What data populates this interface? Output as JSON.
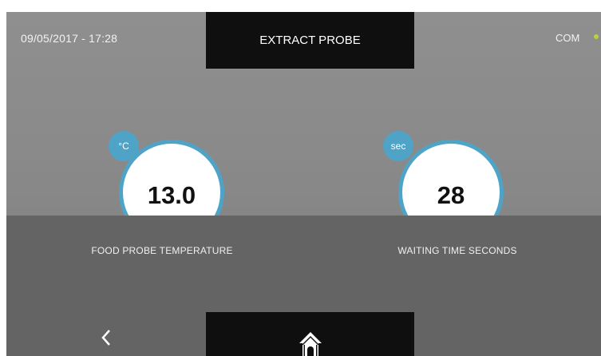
{
  "header": {
    "datetime": "09/05/2017 - 17:28",
    "title": "EXTRACT PROBE",
    "com_label": "COM",
    "com_indicator_color": "#b7d23f"
  },
  "gauges": [
    {
      "unit": "°C",
      "value": "13.0",
      "caption": "FOOD PROBE TEMPERATURE"
    },
    {
      "unit": "sec",
      "value": "28",
      "caption": "WAITING TIME SECONDS"
    }
  ],
  "footer": {
    "back_icon": "chevron-left-icon",
    "home_icon": "home-icon"
  },
  "colors": {
    "accent": "#4fa3c7",
    "background": "#8a8a8a",
    "panel": "#646464",
    "bar": "#0f0f0f"
  }
}
